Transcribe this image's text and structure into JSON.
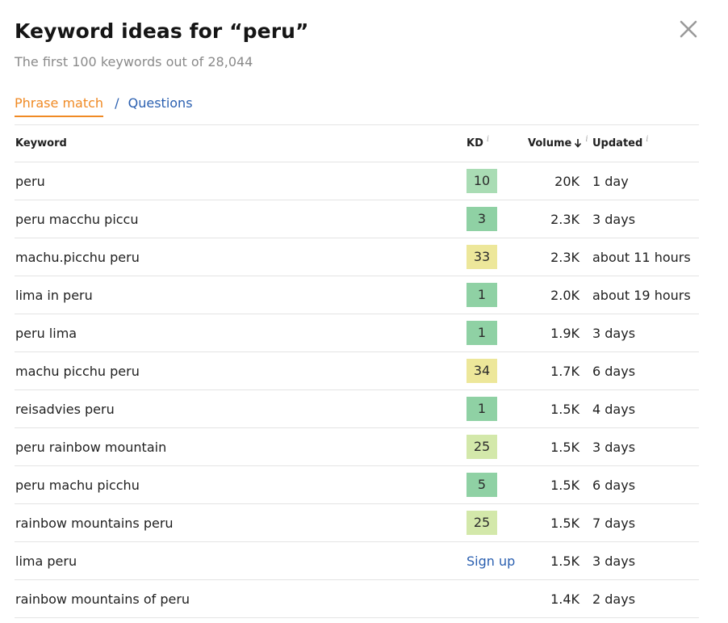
{
  "header": {
    "title": "Keyword ideas for “peru”",
    "subtitle": "The first 100 keywords out of 28,044",
    "close_icon": "close-icon"
  },
  "tabs": [
    {
      "label": "Phrase match",
      "active": true
    },
    {
      "label": "Questions",
      "active": false
    }
  ],
  "tab_separator": "/",
  "table": {
    "columns": {
      "keyword": "Keyword",
      "kd": "KD",
      "volume": "Volume",
      "updated": "Updated"
    },
    "info_glyph": "i",
    "signup_label": "Sign up",
    "rows": [
      {
        "keyword": "peru",
        "kd": "10",
        "kd_color": "#a9dcb4",
        "volume": "20K",
        "updated": "1 day"
      },
      {
        "keyword": "peru macchu piccu",
        "kd": "3",
        "kd_color": "#8fd1a4",
        "volume": "2.3K",
        "updated": "3 days"
      },
      {
        "keyword": "machu.picchu peru",
        "kd": "33",
        "kd_color": "#ede79a",
        "volume": "2.3K",
        "updated": "about 11 hours"
      },
      {
        "keyword": "lima in peru",
        "kd": "1",
        "kd_color": "#8fd1a4",
        "volume": "2.0K",
        "updated": "about 19 hours"
      },
      {
        "keyword": "peru lima",
        "kd": "1",
        "kd_color": "#8fd1a4",
        "volume": "1.9K",
        "updated": "3 days"
      },
      {
        "keyword": "machu picchu peru",
        "kd": "34",
        "kd_color": "#ede79a",
        "volume": "1.7K",
        "updated": "6 days"
      },
      {
        "keyword": "reisadvies peru",
        "kd": "1",
        "kd_color": "#8fd1a4",
        "volume": "1.5K",
        "updated": "4 days"
      },
      {
        "keyword": "peru rainbow mountain",
        "kd": "25",
        "kd_color": "#d3e8aa",
        "volume": "1.5K",
        "updated": "3 days"
      },
      {
        "keyword": "peru machu picchu",
        "kd": "5",
        "kd_color": "#8fd1a4",
        "volume": "1.5K",
        "updated": "6 days"
      },
      {
        "keyword": "rainbow mountains peru",
        "kd": "25",
        "kd_color": "#d3e8aa",
        "volume": "1.5K",
        "updated": "7 days"
      },
      {
        "keyword": "lima peru",
        "kd": "signup",
        "kd_color": "",
        "volume": "1.5K",
        "updated": "3 days"
      },
      {
        "keyword": "rainbow mountains of peru",
        "kd": "",
        "kd_color": "",
        "volume": "1.4K",
        "updated": "2 days"
      }
    ]
  },
  "colors": {
    "accent_orange": "#f08a24",
    "link_blue": "#2a5fb0",
    "divider": "#e4e4e4"
  }
}
